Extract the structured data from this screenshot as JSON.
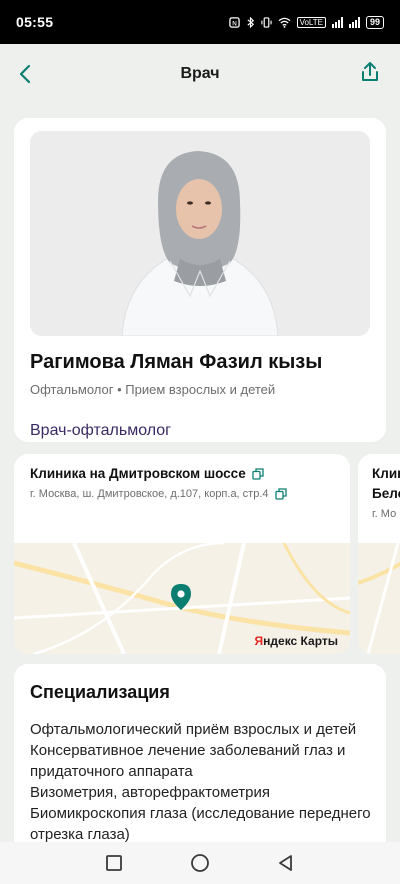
{
  "status": {
    "time": "05:55",
    "battery": "99",
    "network": "VoLTE"
  },
  "header": {
    "title": "Врач"
  },
  "doctor": {
    "name": "Рагимова Ляман Фазил кызы",
    "subtitle": "Офтальмолог • Прием взрослых и детей",
    "role": "Врач-офтальмолог"
  },
  "clinics": [
    {
      "name": "Клиника на Дмитровском шоссе",
      "address": "г. Москва, ш. Дмитровское, д.107, корп.а, стр.4",
      "map_label": "Яндекс Карты"
    },
    {
      "name_line1": "Клин",
      "name_line2": "Бело",
      "address_start": "г. Мо"
    }
  ],
  "specialization": {
    "title": "Специализация",
    "items": [
      "Офтальмологический приём взрослых и детей",
      "Консервативное лечение заболеваний глаз и придаточного аппарата",
      "Визометрия, авторефрактометрия",
      "Биомикроскопия глаза (исследование переднего отрезка глаза)"
    ]
  },
  "colors": {
    "accent": "#0b7e72",
    "role_text": "#3a2a63",
    "background": "#eef0ee"
  },
  "icons": {
    "back": "chevron-left-icon",
    "share": "share-icon",
    "copy": "copy-icon",
    "pin": "map-pin-icon"
  }
}
